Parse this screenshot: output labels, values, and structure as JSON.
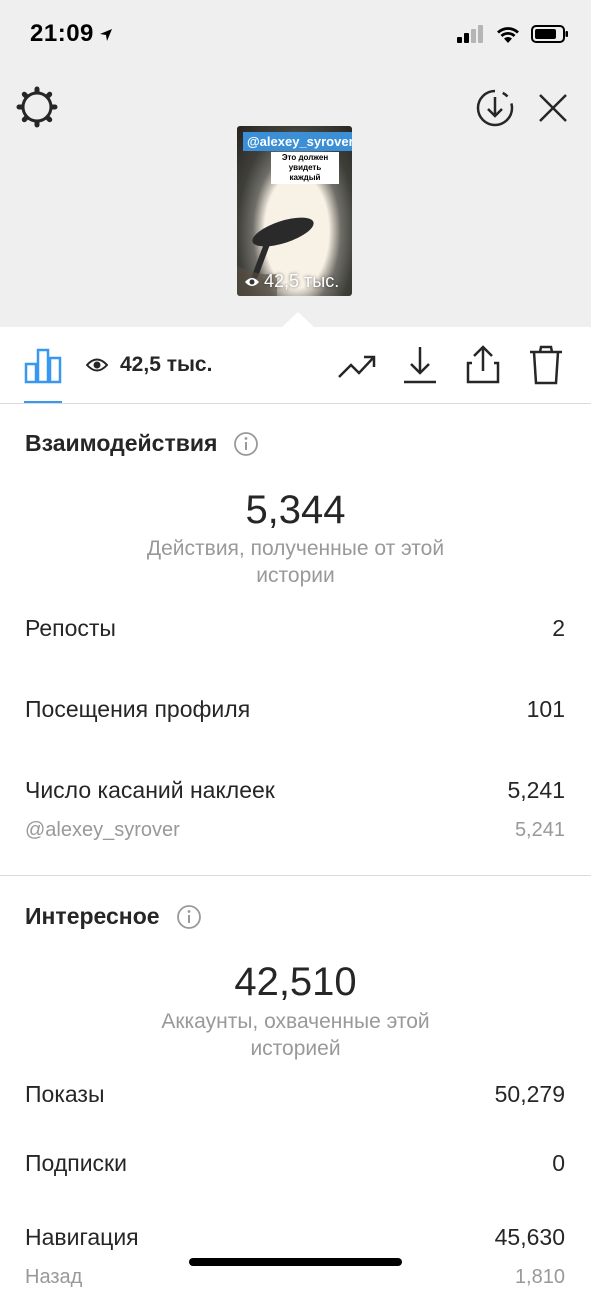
{
  "status_bar": {
    "time": "21:09"
  },
  "story_preview": {
    "username_tag": "@alexey_syrover",
    "sticker_text": "Это должен увидеть каждый",
    "views": "42,5 тыс."
  },
  "toolbar": {
    "views": "42,5 тыс."
  },
  "interactions": {
    "title": "Взаимодействия",
    "total": "5,344",
    "subtitle": "Действия, полученные от этой истории",
    "rows": [
      {
        "label": "Репосты",
        "value": "2"
      },
      {
        "label": "Посещения профиля",
        "value": "101"
      },
      {
        "label": "Число касаний наклеек",
        "value": "5,241"
      },
      {
        "label": "@alexey_syrover",
        "value": "5,241"
      }
    ]
  },
  "discovery": {
    "title": "Интересное",
    "total": "42,510",
    "subtitle": "Аккаунты, охваченные этой историей",
    "rows": [
      {
        "label": "Показы",
        "value": "50,279"
      },
      {
        "label": "Подписки",
        "value": "0"
      },
      {
        "label": "Навигация",
        "value": "45,630"
      },
      {
        "label": "Назад",
        "value": "1,810"
      }
    ]
  },
  "colors": {
    "accent": "#3897f0",
    "muted_text": "#999999",
    "header_bg": "#efefef"
  }
}
